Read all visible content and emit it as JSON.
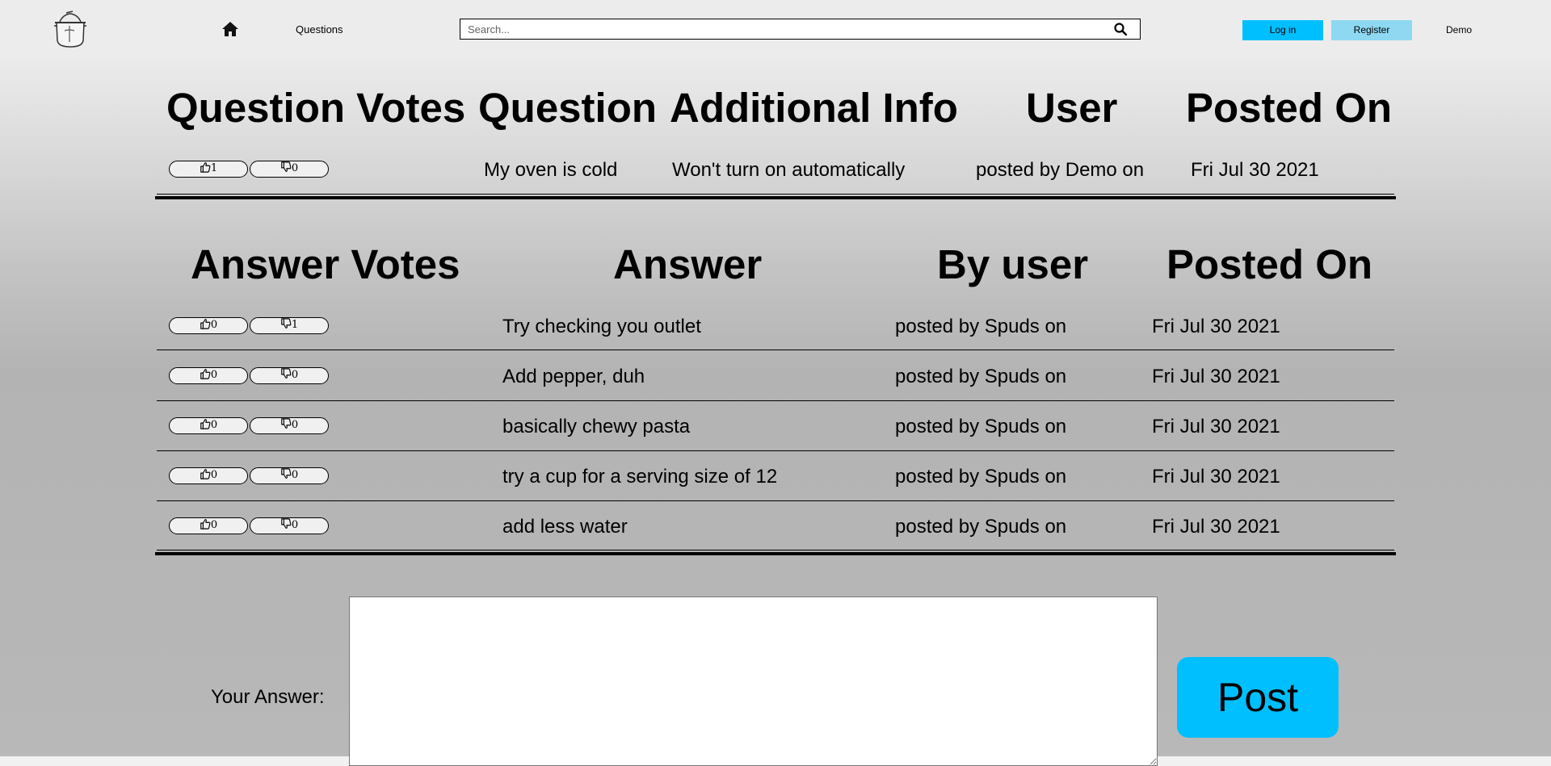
{
  "nav": {
    "questions": "Questions",
    "search_placeholder": "Search...",
    "login": "Log in",
    "register": "Register",
    "user": "Demo"
  },
  "question_table": {
    "headers": [
      "Question Votes",
      "Question",
      "Additional Info",
      "User",
      "Posted On"
    ],
    "row": {
      "up": "1",
      "down": "0",
      "question": "My oven is cold",
      "info": "Won't turn on automatically",
      "user": "posted by Demo on",
      "date": "Fri Jul 30 2021"
    }
  },
  "answer_table": {
    "headers": [
      "Answer Votes",
      "Answer",
      "By user",
      "Posted On"
    ],
    "rows": [
      {
        "up": "0",
        "down": "1",
        "answer": "Try checking you outlet",
        "user": "posted by Spuds on",
        "date": "Fri Jul 30 2021"
      },
      {
        "up": "0",
        "down": "0",
        "answer": "Add pepper, duh",
        "user": "posted by Spuds on",
        "date": "Fri Jul 30 2021"
      },
      {
        "up": "0",
        "down": "0",
        "answer": "basically chewy pasta",
        "user": "posted by Spuds on",
        "date": "Fri Jul 30 2021"
      },
      {
        "up": "0",
        "down": "0",
        "answer": "try a cup for a serving size of 12",
        "user": "posted by Spuds on",
        "date": "Fri Jul 30 2021"
      },
      {
        "up": "0",
        "down": "0",
        "answer": "add less water",
        "user": "posted by Spuds on",
        "date": "Fri Jul 30 2021"
      }
    ]
  },
  "answer_form": {
    "label": "Your Answer:",
    "post": "Post"
  },
  "icons": {
    "home": "home-icon",
    "search": "search-icon",
    "logo": "pot-logo-icon",
    "upvote": "thumbs-up-icon",
    "downvote": "thumbs-down-icon"
  },
  "colors": {
    "login_bg": "#00bfff",
    "register_bg": "#8ed8f2",
    "post_bg": "#00bfff"
  }
}
